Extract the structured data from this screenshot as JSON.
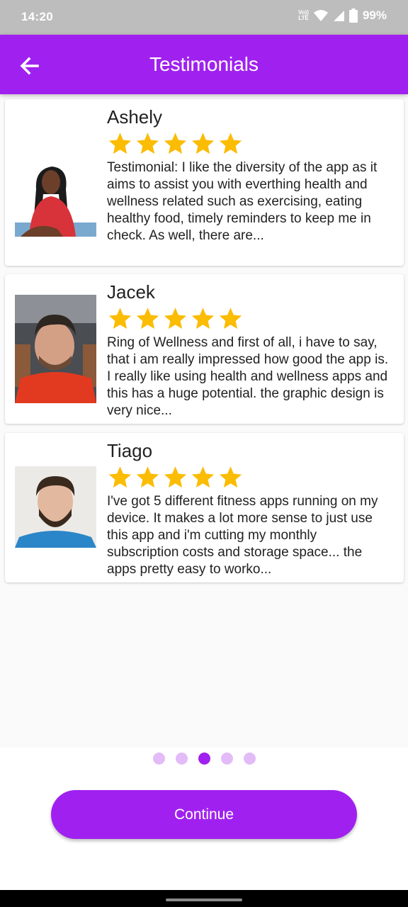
{
  "status_bar": {
    "time": "14:20",
    "network_label": "Vo)) LTE",
    "battery_percent": "99%",
    "icons": [
      "volte-icon",
      "wifi-icon",
      "signal-icon",
      "battery-icon"
    ]
  },
  "app_bar": {
    "title": "Testimonials",
    "back_icon": "arrow-left-icon"
  },
  "testimonials": [
    {
      "name": "Ashely",
      "rating": 5,
      "text": "Testimonial: I like the diversity of the app as it aims to assist you with everthing health and wellness related such as exercising, eating healthy food, timely reminders to keep me in check. As well, there are..."
    },
    {
      "name": "Jacek",
      "rating": 5,
      "text": "Ring of Wellness and first of all, i have to say, that i am really impressed how good the app is. I really like using health and wellness apps and this has a huge potential. the graphic design is very nice..."
    },
    {
      "name": "Tiago",
      "rating": 5,
      "text": "I've got 5 different fitness apps running on my device. It makes a lot more sense to just use this app and i'm cutting my monthly subscription costs and storage space... the apps pretty easy to worko..."
    }
  ],
  "pager": {
    "count": 5,
    "active_index": 2
  },
  "continue_button": {
    "label": "Continue"
  },
  "colors": {
    "accent": "#a021ef",
    "star": "#fbbc04",
    "dot_inactive": "#e2bbf7"
  }
}
